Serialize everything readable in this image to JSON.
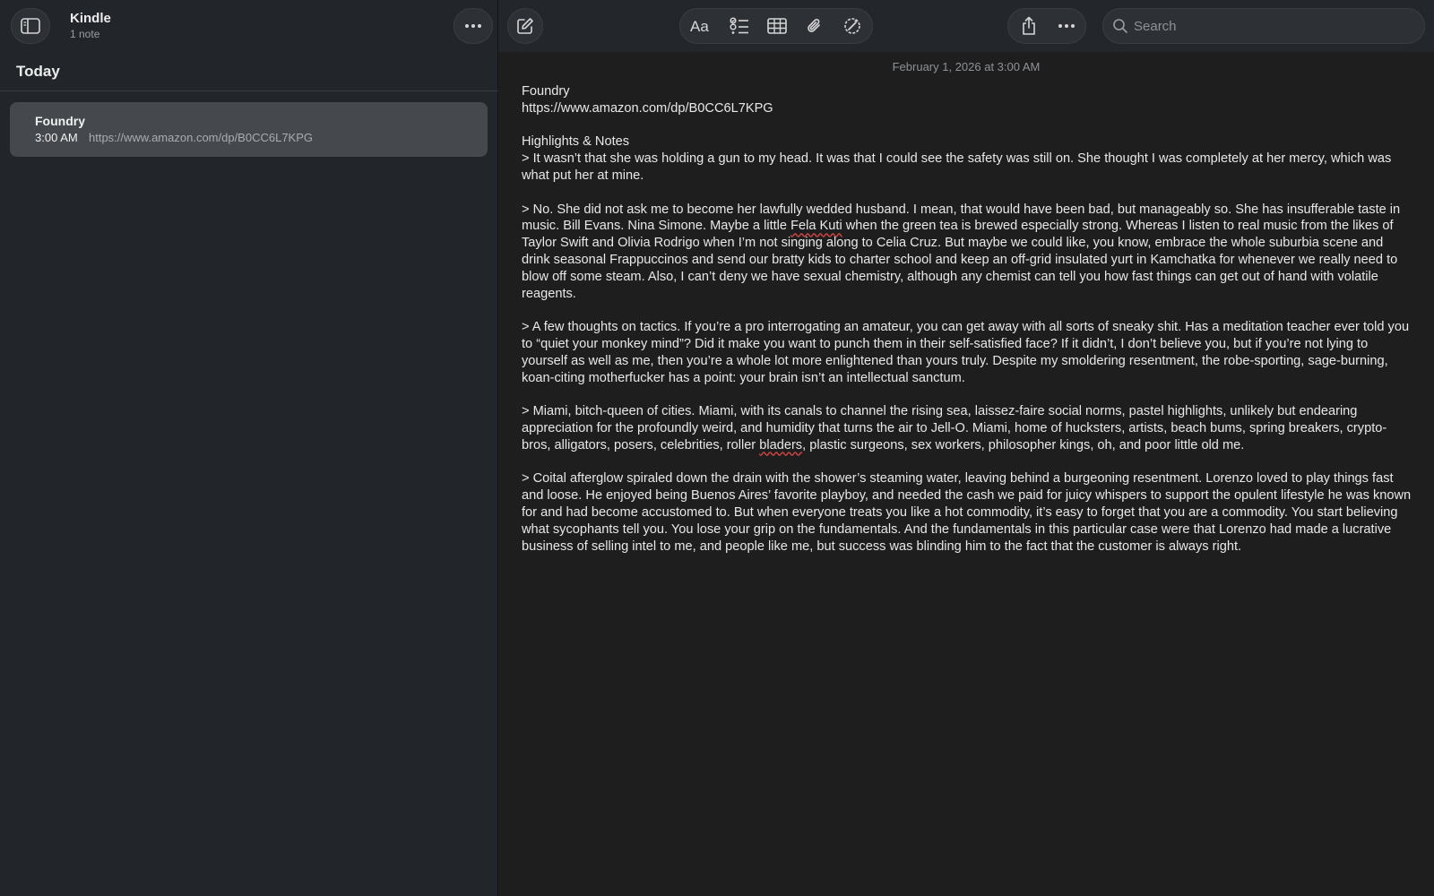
{
  "sidebar": {
    "folder_title": "Kindle",
    "folder_subtitle": "1 note",
    "section_title": "Today",
    "notes": [
      {
        "title": "Foundry",
        "time": "3:00 AM",
        "preview": "https://www.amazon.com/dp/B0CC6L7KPG"
      }
    ]
  },
  "toolbar": {
    "icons": [
      "sidebar-toggle-icon",
      "more-icon",
      "compose-icon",
      "format-text-icon",
      "checklist-icon",
      "table-icon",
      "attachment-icon",
      "writing-tools-icon",
      "share-icon",
      "more-icon"
    ],
    "search_placeholder": "Search"
  },
  "note": {
    "date": "February 1, 2026 at 3:00 AM",
    "title": "Foundry",
    "url": "https://www.amazon.com/dp/B0CC6L7KPG",
    "heading": "Highlights & Notes",
    "p1": "> It wasn’t that she was holding a gun to my head. It was that I could see the safety was still on. She thought I was completely at her mercy, which was what put her at mine.",
    "p2_a": "> No. She did not ask me to become her lawfully wedded husband. I mean, that would have been bad, but manageably so. She has insufferable taste in music. Bill Evans. Nina Simone. Maybe a little ",
    "p2_misspelled": "Fela Kuti",
    "p2_b": " when the green tea is brewed especially strong. Whereas I listen to real music from the likes of Taylor Swift and Olivia Rodrigo when I’m not singing along to Celia Cruz. But maybe we could like, you know, embrace the whole suburbia scene and drink seasonal Frappuccinos and send our bratty kids to charter school and keep an off-grid insulated yurt in Kamchatka for whenever we really need to blow off some steam. Also, I can’t deny we have sexual chemistry, although any chemist can tell you how fast things can get out of hand with volatile reagents.",
    "p3": "> A few thoughts on tactics. If you’re a pro interrogating an amateur, you can get away with all sorts of sneaky shit. Has a meditation teacher ever told you to “quiet your monkey mind”? Did it make you want to punch them in their self-satisfied face? If it didn’t, I don’t believe you, but if you’re not lying to yourself as well as me, then you’re a whole lot more enlightened than yours truly. Despite my smoldering resentment, the robe-sporting, sage-burning, koan-citing motherfucker has a point: your brain isn’t an intellectual sanctum.",
    "p4_a": "> Miami, bitch-queen of cities. Miami, with its canals to channel the rising sea, laissez-faire social norms, pastel highlights, unlikely but endearing appreciation for the profoundly weird, and humidity that turns the air to Jell-O. Miami, home of hucksters, artists, beach bums, spring breakers, crypto-bros, alligators, posers, celebrities, roller ",
    "p4_misspelled": "bladers",
    "p4_b": ", plastic surgeons, sex workers, philosopher kings, oh, and poor little old me.",
    "p5": "> Coital afterglow spiraled down the drain with the shower’s steaming water, leaving behind a burgeoning resentment. Lorenzo loved to play things fast and loose. He enjoyed being Buenos Aires’ favorite playboy, and needed the cash we paid for juicy whispers to support the opulent lifestyle he was known for and had become accustomed to. But when everyone treats you like a hot commodity, it’s easy to forget that you are a commodity. You start believing what sycophants tell you. You lose your grip on the fundamentals. And the fundamentals in this particular case were that Lorenzo had made a lucrative business of selling intel to me, and people like me, but success was blinding him to the fact that the customer is always right."
  }
}
